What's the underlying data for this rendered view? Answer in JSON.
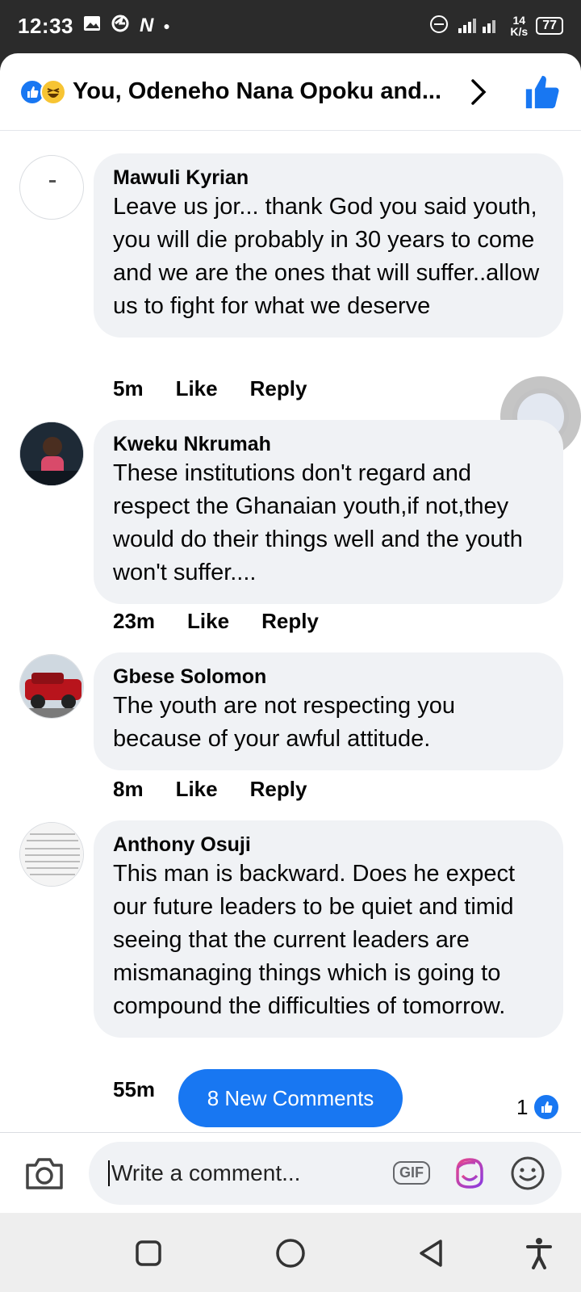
{
  "status_bar": {
    "time": "12:33",
    "speed_value": "14",
    "speed_unit": "K/s",
    "battery": "77"
  },
  "header": {
    "title": "You, Odeneho Nana Opoku and...",
    "icons": [
      "like-reaction-icon",
      "haha-reaction-icon",
      "chevron-right-icon",
      "thumbs-up-icon"
    ]
  },
  "comments": [
    {
      "name": "Mawuli Kyrian",
      "text": "Leave us jor... thank God you said youth, you will die probably in 30 years to come and we are the ones that will suffer..allow us to fight for what we deserve",
      "time": "5m",
      "like_label": "Like",
      "reply_label": "Reply"
    },
    {
      "name": "Kweku Nkrumah",
      "text": "These institutions don't regard and respect the Ghanaian youth,if not,they would do their things well and the youth won't suffer....",
      "time": "23m",
      "like_label": "Like",
      "reply_label": "Reply"
    },
    {
      "name": "Gbese Solomon",
      "text": "The youth are not respecting you because of your awful attitude.",
      "time": "8m",
      "like_label": "Like",
      "reply_label": "Reply"
    },
    {
      "name": "Anthony Osuji",
      "text": "This man is backward. Does he expect our future leaders to be quiet and timid seeing that the current leaders are mismanaging things which is going to compound the difficulties of tomorrow.",
      "time": "55m",
      "likes": "1"
    }
  ],
  "new_comments_button": "8 New Comments",
  "composer": {
    "placeholder": "Write a comment...",
    "gif_label": "GIF"
  },
  "colors": {
    "accent": "#1877f2",
    "bubble": "#f0f2f5",
    "status_bar": "#2b2b2b"
  }
}
